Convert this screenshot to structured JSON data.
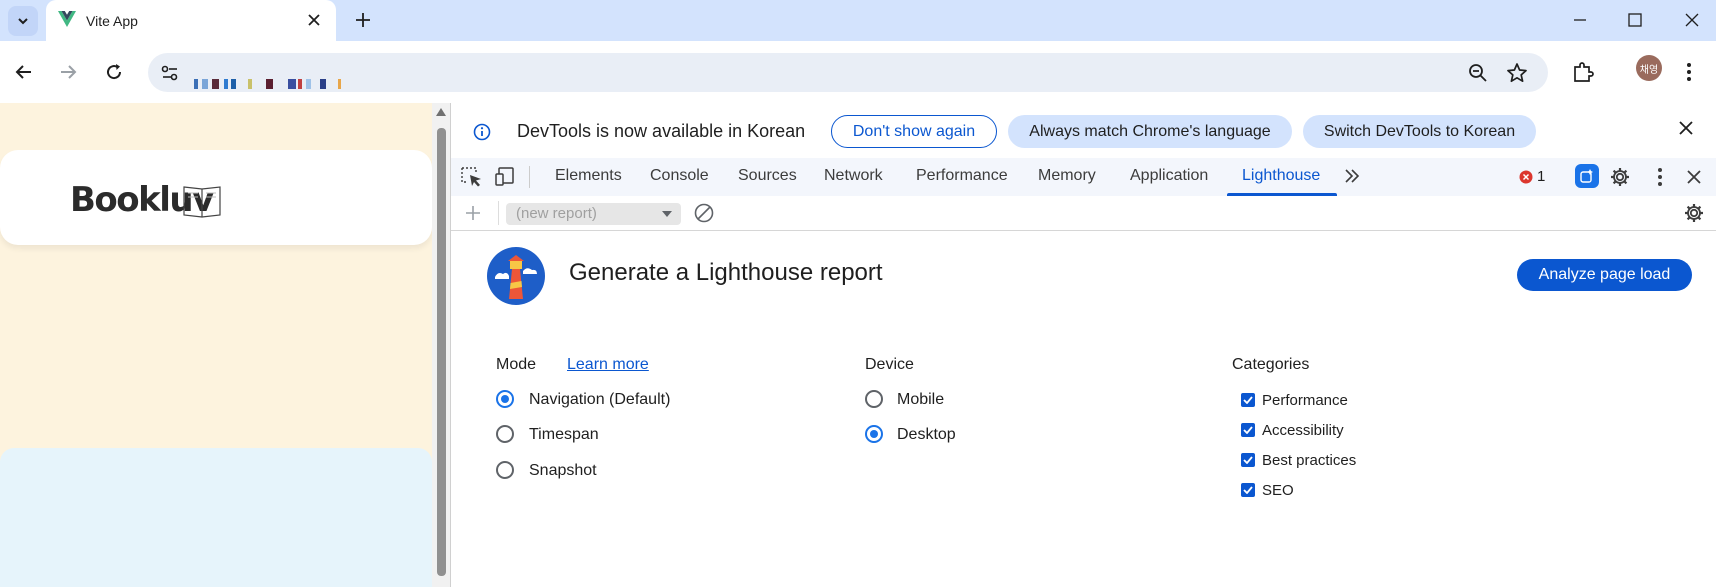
{
  "browser": {
    "tab_title": "Vite App",
    "profile_initials": "채영"
  },
  "page": {
    "logo_text": "Bookluv"
  },
  "devtools": {
    "infobar": {
      "message": "DevTools is now available in Korean",
      "dont_show": "Don't show again",
      "match_language": "Always match Chrome's language",
      "switch_language": "Switch DevTools to Korean"
    },
    "tabs": [
      "Elements",
      "Console",
      "Sources",
      "Network",
      "Performance",
      "Memory",
      "Application",
      "Lighthouse"
    ],
    "active_tab": "Lighthouse",
    "error_count": "1",
    "report_select_placeholder": "(new report)",
    "lighthouse": {
      "title": "Generate a Lighthouse report",
      "analyze_button": "Analyze page load",
      "mode": {
        "heading": "Mode",
        "learn_more": "Learn more",
        "options": [
          "Navigation (Default)",
          "Timespan",
          "Snapshot"
        ],
        "selected": "Navigation (Default)"
      },
      "device": {
        "heading": "Device",
        "options": [
          "Mobile",
          "Desktop"
        ],
        "selected": "Desktop"
      },
      "categories": {
        "heading": "Categories",
        "options": [
          "Performance",
          "Accessibility",
          "Best practices",
          "SEO"
        ],
        "checked": [
          true,
          true,
          true,
          true
        ]
      }
    }
  },
  "colors": {
    "accent": "#0b57d0",
    "titlebar": "#d3e3fd",
    "page_bg": "#fdf3de"
  }
}
